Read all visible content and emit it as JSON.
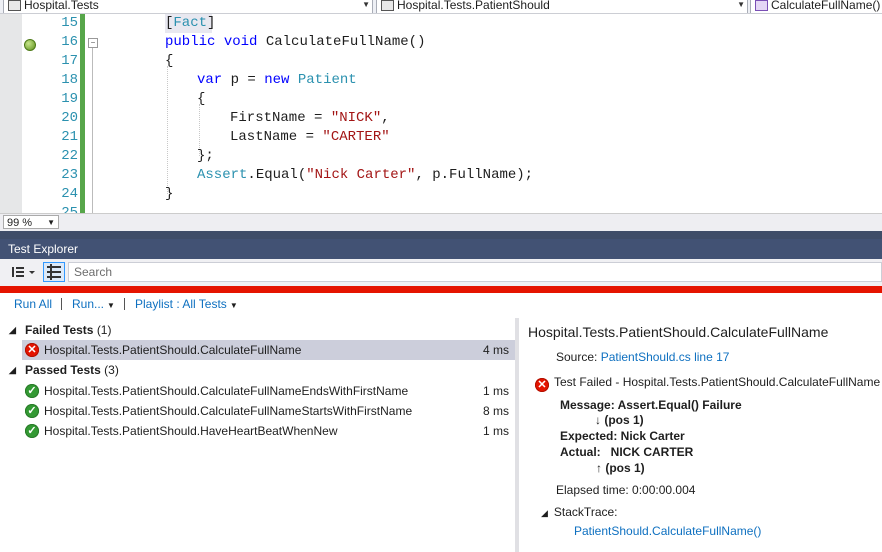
{
  "nav": {
    "project": "Hospital.Tests",
    "class": "Hospital.Tests.PatientShould",
    "member": "CalculateFullName()"
  },
  "editor": {
    "lines": [
      {
        "num": "15"
      },
      {
        "num": "16"
      },
      {
        "num": "17"
      },
      {
        "num": "18"
      },
      {
        "num": "19"
      },
      {
        "num": "20"
      },
      {
        "num": "21"
      },
      {
        "num": "22"
      },
      {
        "num": "23"
      },
      {
        "num": "24"
      },
      {
        "num": "25"
      }
    ],
    "tokens": {
      "bracket_open": "[",
      "fact": "Fact",
      "bracket_close": "]",
      "kw_public": "public",
      "kw_void": "void",
      "method_sig": "CalculateFullName()",
      "brace_open": "{",
      "kw_var": "var",
      "var_p": "p =",
      "kw_new": "new",
      "type_patient": "Patient",
      "first_name": "FirstName =",
      "str_nick": "\"NICK\"",
      "comma": ",",
      "last_name": "LastName =",
      "str_carter": "\"CARTER\"",
      "brace_close_semi": "};",
      "assert": "Assert",
      "assert_call": ".Equal(",
      "str_nick_carter": "\"Nick Carter\"",
      "assert_rest": ", p.FullName);",
      "brace_close": "}"
    }
  },
  "zoom": "99 %",
  "test_explorer": {
    "title": "Test Explorer",
    "search_placeholder": "Search",
    "commands": {
      "run_all": "Run All",
      "run": "Run...",
      "playlist": "Playlist : All Tests"
    },
    "groups": {
      "failed": {
        "label": "Failed Tests",
        "count": "(1)",
        "tests": [
          {
            "name": "Hospital.Tests.PatientShould.CalculateFullName",
            "duration": "4 ms"
          }
        ]
      },
      "passed": {
        "label": "Passed Tests",
        "count": "(3)",
        "tests": [
          {
            "name": "Hospital.Tests.PatientShould.CalculateFullNameEndsWithFirstName",
            "duration": "1 ms"
          },
          {
            "name": "Hospital.Tests.PatientShould.CalculateFullNameStartsWithFirstName",
            "duration": "8 ms"
          },
          {
            "name": "Hospital.Tests.PatientShould.HaveHeartBeatWhenNew",
            "duration": "1 ms"
          }
        ]
      }
    },
    "details": {
      "title": "Hospital.Tests.PatientShould.CalculateFullName",
      "source_label": "Source:",
      "source_link": "PatientShould.cs line 17",
      "failed_text": "Test Failed - Hospital.Tests.PatientShould.CalculateFullName",
      "message": "Message: Assert.Equal() Failure",
      "pos1": "↓ (pos 1)",
      "expected": "Expected: Nick Carter",
      "actual": "Actual:   NICK CARTER",
      "pos2": "↑ (pos 1)",
      "elapsed": "Elapsed time: 0:00:00.004",
      "stacktrace_label": "StackTrace:",
      "stacktrace_link": "PatientShould.CalculateFullName()"
    }
  },
  "colors": {
    "accent_red": "#e51400",
    "pass_green": "#339933",
    "link_blue": "#0e70c0",
    "panel_title": "#425274"
  }
}
